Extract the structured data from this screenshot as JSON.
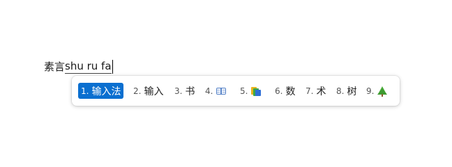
{
  "editor": {
    "committed_text": "素言",
    "composition_text": "shu ru fa"
  },
  "candidates": [
    {
      "index": "1.",
      "text": "输入法",
      "selected": true
    },
    {
      "index": "2.",
      "text": "输入"
    },
    {
      "index": "3.",
      "text": "书"
    },
    {
      "index": "4.",
      "icon": "open-book-icon"
    },
    {
      "index": "5.",
      "icon": "books-icon"
    },
    {
      "index": "6.",
      "text": "数"
    },
    {
      "index": "7.",
      "text": "术"
    },
    {
      "index": "8.",
      "text": "树"
    },
    {
      "index": "9.",
      "icon": "deciduous-tree-icon"
    }
  ],
  "colors": {
    "selection_background": "#0a6fd0",
    "selection_text": "#ffffff"
  }
}
